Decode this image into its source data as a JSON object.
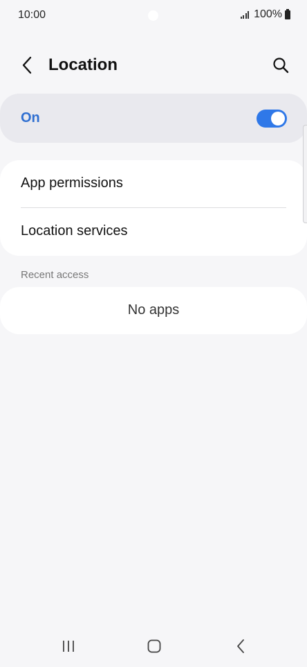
{
  "status_bar": {
    "time": "10:00",
    "battery_text": "100%"
  },
  "header": {
    "title": "Location",
    "back_icon": "chevron-left-icon",
    "search_icon": "search-icon"
  },
  "location_toggle": {
    "label": "On",
    "state": true,
    "accent_color": "#2f78e8"
  },
  "menu": {
    "items": [
      {
        "label": "App permissions"
      },
      {
        "label": "Location services"
      }
    ]
  },
  "recent_access": {
    "header": "Recent access",
    "empty_text": "No apps"
  },
  "navbar": {
    "recents_icon": "recents-icon",
    "home_icon": "home-icon",
    "back_icon": "back-icon"
  }
}
